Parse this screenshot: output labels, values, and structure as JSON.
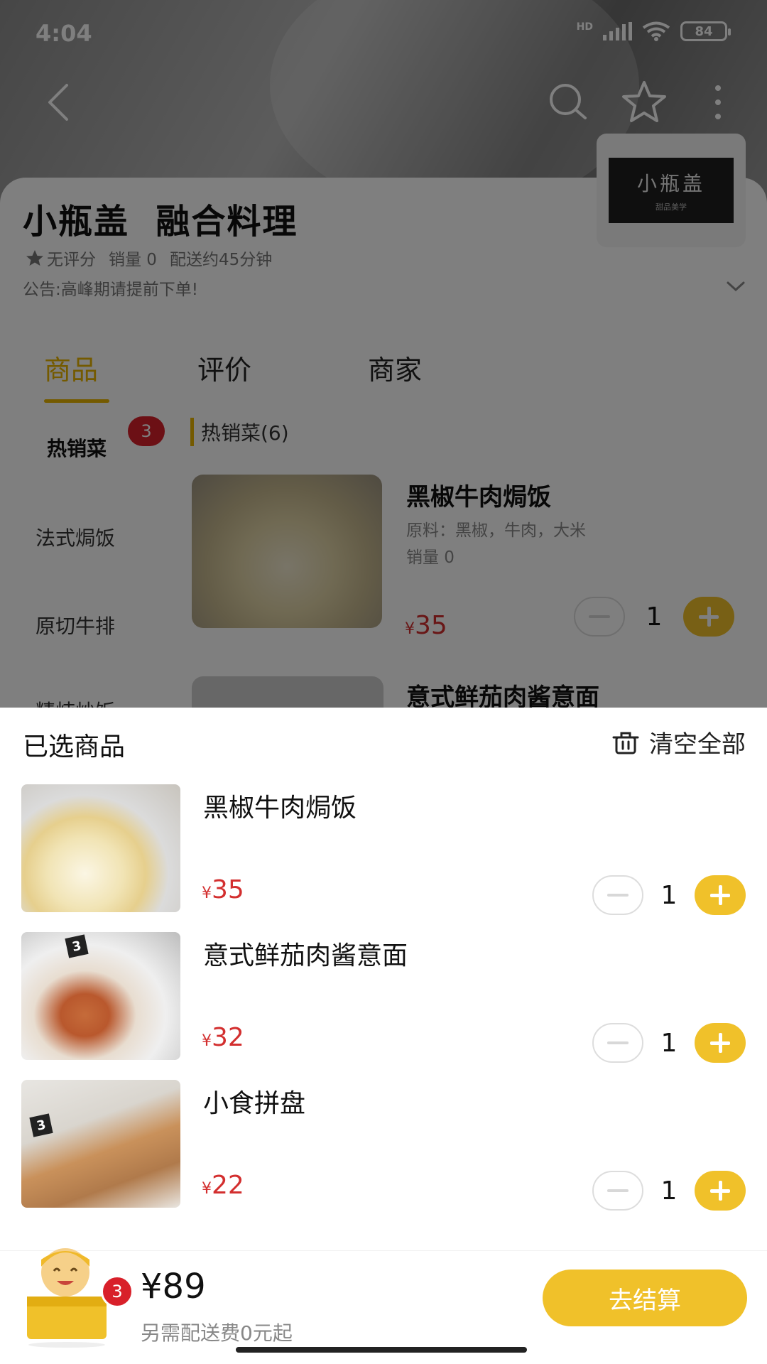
{
  "status_bar": {
    "time": "4:04",
    "network": "HD",
    "battery": "84"
  },
  "store": {
    "name": "小瓶盖  融合料理",
    "rating": "无评分",
    "sales": "销量 0",
    "delivery": "配送约45分钟",
    "notice": "公告:高峰期请提前下单!",
    "logo_text": "小瓶盖",
    "logo_subtext": "甜品美学"
  },
  "tabs": [
    {
      "label": "商品",
      "active": true
    },
    {
      "label": "评价",
      "active": false
    },
    {
      "label": "商家",
      "active": false
    }
  ],
  "categories": {
    "items": [
      "热销菜",
      "法式焗饭",
      "原切牛排",
      "精炖炒饭"
    ],
    "active_badge": "3"
  },
  "section": {
    "title": "热销菜(6)"
  },
  "menu_product": {
    "name": "黑椒牛肉焗饭",
    "ingredients": "原料：黑椒，牛肉，大米",
    "sales": "销量 0",
    "currency": "¥",
    "price": "35",
    "qty": "1"
  },
  "menu_product2": {
    "name": "意式鲜茄肉酱意面"
  },
  "cart": {
    "title": "已选商品",
    "clear_label": "清空全部",
    "items": [
      {
        "name": "黑椒牛肉焗饭",
        "currency": "¥",
        "price": "35",
        "qty": "1"
      },
      {
        "name": "意式鲜茄肉酱意面",
        "currency": "¥",
        "price": "32",
        "qty": "1"
      },
      {
        "name": "小食拼盘",
        "currency": "¥",
        "price": "22",
        "qty": "1"
      }
    ],
    "badge_count": "3",
    "total": "¥89",
    "delivery_note": "另需配送费0元起",
    "checkout_label": "去结算"
  },
  "colors": {
    "accent": "#f0c12a",
    "price": "#d32f2f",
    "badge": "#d8202a"
  },
  "icons": [
    "back-icon",
    "search-icon",
    "star-icon",
    "more-icon",
    "chevron-down-icon",
    "trash-icon",
    "minus-icon",
    "plus-icon"
  ]
}
